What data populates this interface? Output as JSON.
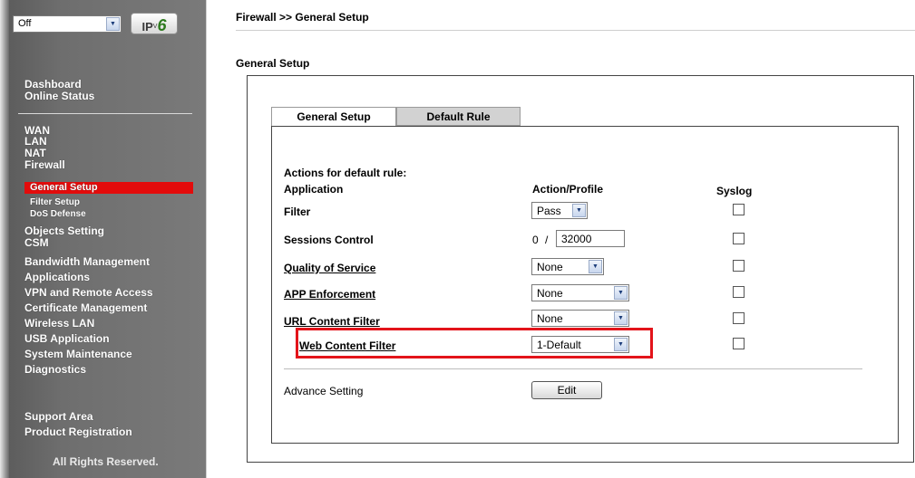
{
  "sidebar": {
    "mode_select": "Off",
    "ipv6_badge": {
      "ip": "IP",
      "v": "V",
      "six": "6"
    },
    "nav_group1": [
      "Dashboard",
      "Online Status"
    ],
    "nav_group2": [
      "WAN",
      "LAN",
      "NAT",
      "Firewall"
    ],
    "firewall_sub": {
      "active": "General Setup",
      "items": [
        "Filter Setup",
        "DoS Defense"
      ]
    },
    "nav_group3": [
      "Objects Setting",
      "CSM",
      "Bandwidth Management",
      "Applications",
      "VPN and Remote Access",
      "Certificate Management",
      "Wireless LAN",
      "USB Application",
      "System Maintenance",
      "Diagnostics"
    ],
    "nav_group4": [
      "Support Area",
      "Product Registration"
    ],
    "footer": "All Rights Reserved."
  },
  "breadcrumb": "Firewall >> General Setup",
  "section_title": "General Setup",
  "tabs": [
    "General Setup",
    "Default Rule"
  ],
  "panel": {
    "actions_title": "Actions for default rule:",
    "headers": {
      "application": "Application",
      "action": "Action/Profile",
      "syslog": "Syslog"
    },
    "rows": {
      "filter": {
        "label": "Filter",
        "value": "Pass"
      },
      "sessions": {
        "label": "Sessions Control",
        "current": "0",
        "slash": "/",
        "limit": "32000"
      },
      "qos": {
        "label": "Quality of Service",
        "value": "None"
      },
      "app": {
        "label": "APP Enforcement",
        "value": "None"
      },
      "url": {
        "label": "URL Content Filter",
        "value": "None"
      },
      "web": {
        "label": "Web Content Filter",
        "value": "1-Default"
      }
    },
    "advance_label": "Advance Setting",
    "edit_button": "Edit"
  },
  "colors": {
    "highlight": "#e3141a",
    "active_nav": "#e30b0b",
    "ipv6_green": "#2d7a1e"
  },
  "icons": {
    "dropdown_arrow": "▼"
  }
}
